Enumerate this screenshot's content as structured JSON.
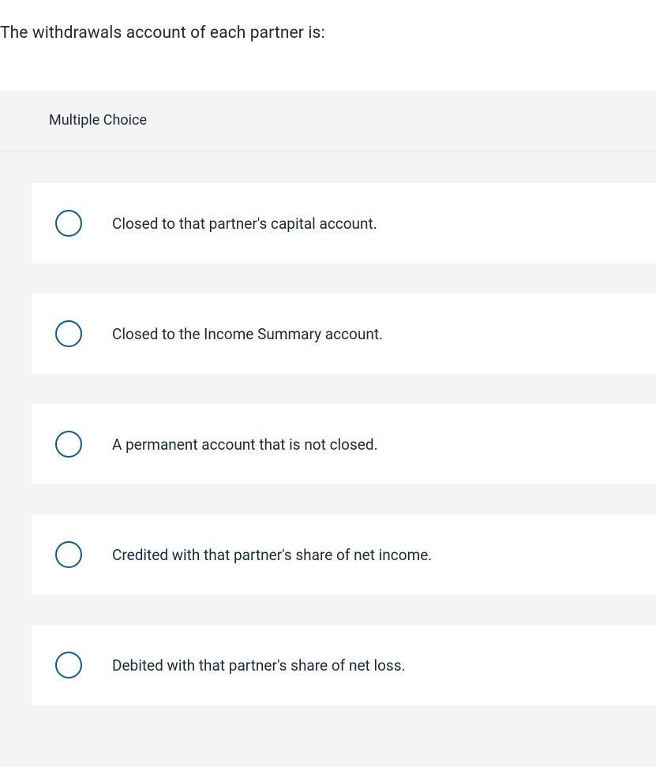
{
  "question": "The withdrawals account of each partner is:",
  "question_type": "Multiple Choice",
  "options": [
    {
      "text": "Closed to that partner's capital account."
    },
    {
      "text": "Closed to the Income Summary account."
    },
    {
      "text": "A permanent account that is not closed."
    },
    {
      "text": "Credited with that partner's share of net income."
    },
    {
      "text": "Debited with that partner's share of net loss."
    }
  ]
}
